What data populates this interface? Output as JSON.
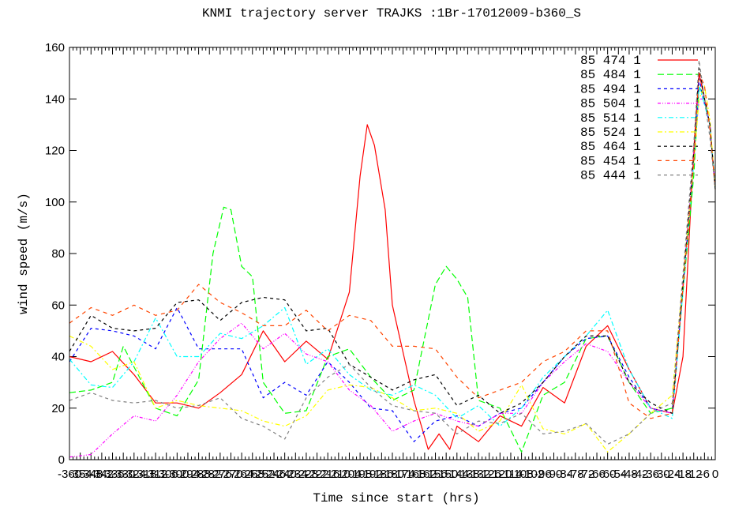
{
  "chart_data": {
    "type": "line",
    "title": "KNMI trajectory server TRAJKS :1Br-17012009-b360_S",
    "xlabel": "Time since start (hrs)",
    "ylabel": "wind speed (m/s)",
    "xlim": [
      -360,
      0
    ],
    "ylim": [
      0,
      160
    ],
    "x_tick_step": 6,
    "y_ticks": [
      0,
      20,
      40,
      60,
      80,
      100,
      120,
      140,
      160
    ],
    "grid": false,
    "legend_position": "top-right",
    "common_x": [
      -360,
      -348,
      -336,
      -324,
      -312,
      -300,
      -288,
      -276,
      -264,
      -252,
      -240,
      -228,
      -216,
      -204,
      -192,
      -180,
      -168,
      -156,
      -144,
      -132,
      -120,
      -108,
      -96,
      -84,
      -72,
      -60,
      -48,
      -36,
      -24,
      -12,
      -9,
      -6,
      -3,
      0
    ],
    "series": [
      {
        "name": "85  474  1",
        "color": "#ff0000",
        "dash": "solid",
        "points": [
          [
            -360,
            40
          ],
          [
            -348,
            38
          ],
          [
            -336,
            42
          ],
          [
            -324,
            33
          ],
          [
            -312,
            22
          ],
          [
            -300,
            22
          ],
          [
            -288,
            20
          ],
          [
            -276,
            26
          ],
          [
            -264,
            33
          ],
          [
            -252,
            50
          ],
          [
            -240,
            38
          ],
          [
            -228,
            46
          ],
          [
            -216,
            39
          ],
          [
            -204,
            65
          ],
          [
            -198,
            110
          ],
          [
            -194,
            130
          ],
          [
            -190,
            122
          ],
          [
            -184,
            97
          ],
          [
            -180,
            60
          ],
          [
            -168,
            23
          ],
          [
            -160,
            4
          ],
          [
            -154,
            10
          ],
          [
            -148,
            4
          ],
          [
            -144,
            13
          ],
          [
            -132,
            7
          ],
          [
            -120,
            17
          ],
          [
            -108,
            13
          ],
          [
            -96,
            28
          ],
          [
            -84,
            22
          ],
          [
            -72,
            44
          ],
          [
            -60,
            52
          ],
          [
            -48,
            35
          ],
          [
            -36,
            20
          ],
          [
            -24,
            18
          ],
          [
            -18,
            40
          ],
          [
            -12,
            120
          ],
          [
            -9,
            150
          ],
          [
            -6,
            140
          ],
          [
            -3,
            130
          ],
          [
            0,
            105
          ]
        ]
      },
      {
        "name": "85  484  1",
        "color": "#00ff00",
        "dash": "long-dash",
        "points": [
          [
            -360,
            26
          ],
          [
            -348,
            27
          ],
          [
            -336,
            30
          ],
          [
            -330,
            44
          ],
          [
            -324,
            36
          ],
          [
            -312,
            20
          ],
          [
            -300,
            17
          ],
          [
            -288,
            31
          ],
          [
            -280,
            80
          ],
          [
            -274,
            98
          ],
          [
            -270,
            97
          ],
          [
            -264,
            75
          ],
          [
            -258,
            71
          ],
          [
            -252,
            30
          ],
          [
            -240,
            18
          ],
          [
            -228,
            19
          ],
          [
            -216,
            40
          ],
          [
            -204,
            43
          ],
          [
            -192,
            32
          ],
          [
            -180,
            23
          ],
          [
            -168,
            27
          ],
          [
            -156,
            68
          ],
          [
            -150,
            75
          ],
          [
            -144,
            70
          ],
          [
            -138,
            63
          ],
          [
            -132,
            23
          ],
          [
            -120,
            20
          ],
          [
            -108,
            3
          ],
          [
            -96,
            25
          ],
          [
            -84,
            30
          ],
          [
            -72,
            47
          ],
          [
            -60,
            48
          ],
          [
            -48,
            30
          ],
          [
            -36,
            18
          ],
          [
            -24,
            20
          ],
          [
            -12,
            110
          ],
          [
            -9,
            145
          ],
          [
            -6,
            140
          ],
          [
            -3,
            130
          ],
          [
            0,
            105
          ]
        ]
      },
      {
        "name": "85  494  1",
        "color": "#0000ff",
        "dash": "dash",
        "values": [
          38,
          51,
          50,
          48,
          43,
          59,
          43,
          43,
          43,
          24,
          30,
          25,
          38,
          30,
          20,
          19,
          7,
          15,
          17,
          13,
          18,
          20,
          30,
          40,
          47,
          48,
          32,
          20,
          18,
          115,
          148,
          138,
          130,
          105
        ]
      },
      {
        "name": "85  504  1",
        "color": "#ff00ff",
        "dash": "dash-dot-dot",
        "values": [
          1,
          2,
          10,
          17,
          15,
          25,
          38,
          47,
          53,
          43,
          49,
          41,
          38,
          27,
          21,
          11,
          15,
          18,
          15,
          13,
          18,
          18,
          30,
          38,
          45,
          42,
          30,
          20,
          18,
          118,
          140,
          140,
          130,
          105
        ]
      },
      {
        "name": "85  514  1",
        "color": "#00ffff",
        "dash": "dash-dot",
        "values": [
          39,
          29,
          28,
          38,
          55,
          40,
          40,
          49,
          47,
          52,
          59,
          37,
          43,
          33,
          27,
          25,
          29,
          25,
          16,
          21,
          13,
          20,
          32,
          40,
          48,
          58,
          35,
          20,
          16,
          115,
          145,
          138,
          130,
          105
        ]
      },
      {
        "name": "85  524  1",
        "color": "#ffff00",
        "dash": "dash-dot",
        "values": [
          48,
          44,
          35,
          38,
          20,
          23,
          21,
          20,
          19,
          15,
          13,
          17,
          27,
          29,
          28,
          24,
          19,
          20,
          18,
          11,
          15,
          29,
          12,
          10,
          14,
          3,
          10,
          18,
          25,
          115,
          140,
          145,
          132,
          105
        ]
      },
      {
        "name": "85  464  1",
        "color": "#000000",
        "dash": "dash",
        "values": [
          42,
          56,
          51,
          50,
          51,
          61,
          62,
          54,
          61,
          63,
          62,
          50,
          51,
          37,
          32,
          27,
          31,
          33,
          21,
          25,
          18,
          22,
          30,
          40,
          48,
          48,
          30,
          22,
          18,
          118,
          152,
          140,
          130,
          105
        ]
      },
      {
        "name": "85  454  1",
        "color": "#ff4500",
        "dash": "dash-wide",
        "values": [
          53,
          59,
          56,
          60,
          56,
          58,
          68,
          61,
          57,
          52,
          52,
          58,
          50,
          56,
          54,
          44,
          44,
          43,
          32,
          24,
          27,
          30,
          38,
          42,
          50,
          50,
          22,
          16,
          18,
          115,
          150,
          145,
          128,
          105
        ]
      },
      {
        "name": "85  444  1",
        "color": "#808080",
        "dash": "dash",
        "values": [
          23,
          26,
          23,
          22,
          23,
          20,
          21,
          24,
          16,
          13,
          8,
          24,
          32,
          37,
          28,
          21,
          19,
          18,
          10,
          15,
          14,
          18,
          10,
          11,
          14,
          6,
          10,
          18,
          22,
          122,
          155,
          140,
          125,
          105
        ]
      }
    ]
  }
}
